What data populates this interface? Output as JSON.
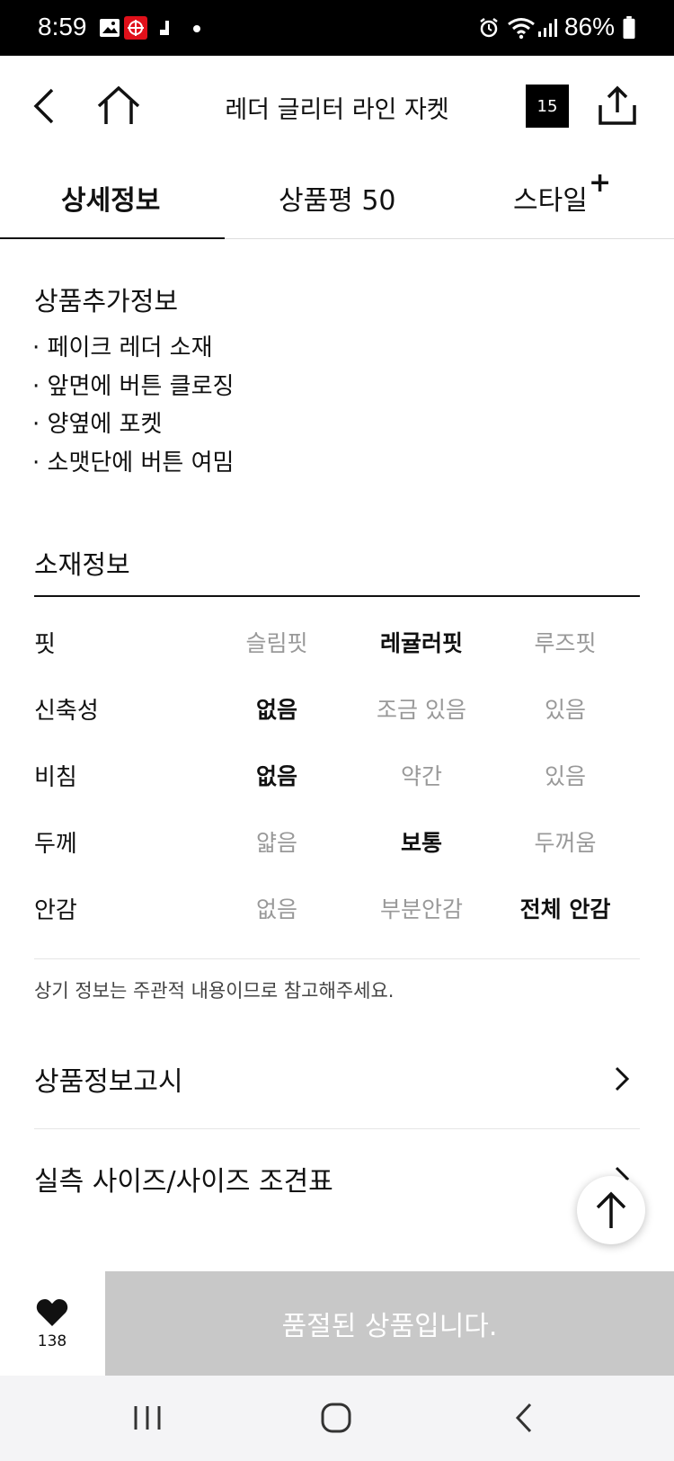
{
  "status": {
    "time": "8:59",
    "battery": "86%"
  },
  "header": {
    "title": "레더 글리터 라인 자켓",
    "cart_count": "15"
  },
  "tabs": [
    {
      "label": "상세정보"
    },
    {
      "label": "상품평 50"
    },
    {
      "label": "스타일"
    }
  ],
  "extra_info": {
    "title": "상품추가정보",
    "items": [
      "· 페이크 레더 소재",
      "· 앞면에 버튼 클로징",
      "· 양옆에 포켓",
      "· 소맷단에 버튼 여밈"
    ]
  },
  "material": {
    "title": "소재정보",
    "rows": [
      {
        "label": "핏",
        "options": [
          "슬림핏",
          "레귤러핏",
          "루즈핏"
        ],
        "selected": 1
      },
      {
        "label": "신축성",
        "options": [
          "없음",
          "조금 있음",
          "있음"
        ],
        "selected": 0
      },
      {
        "label": "비침",
        "options": [
          "없음",
          "약간",
          "있음"
        ],
        "selected": 0
      },
      {
        "label": "두께",
        "options": [
          "얇음",
          "보통",
          "두꺼움"
        ],
        "selected": 1
      },
      {
        "label": "안감",
        "options": [
          "없음",
          "부분안감",
          "전체 안감"
        ],
        "selected": 2
      }
    ],
    "note": "상기 정보는 주관적 내용이므로 참고해주세요."
  },
  "links": {
    "notice": "상품정보고시",
    "size": "실측 사이즈/사이즈 조견표"
  },
  "bottom": {
    "like_count": "138",
    "soldout_label": "품절된 상품입니다."
  },
  "colors": {
    "soldout_bg": "#c8c8c8",
    "text": "#111111",
    "muted": "#999999"
  }
}
